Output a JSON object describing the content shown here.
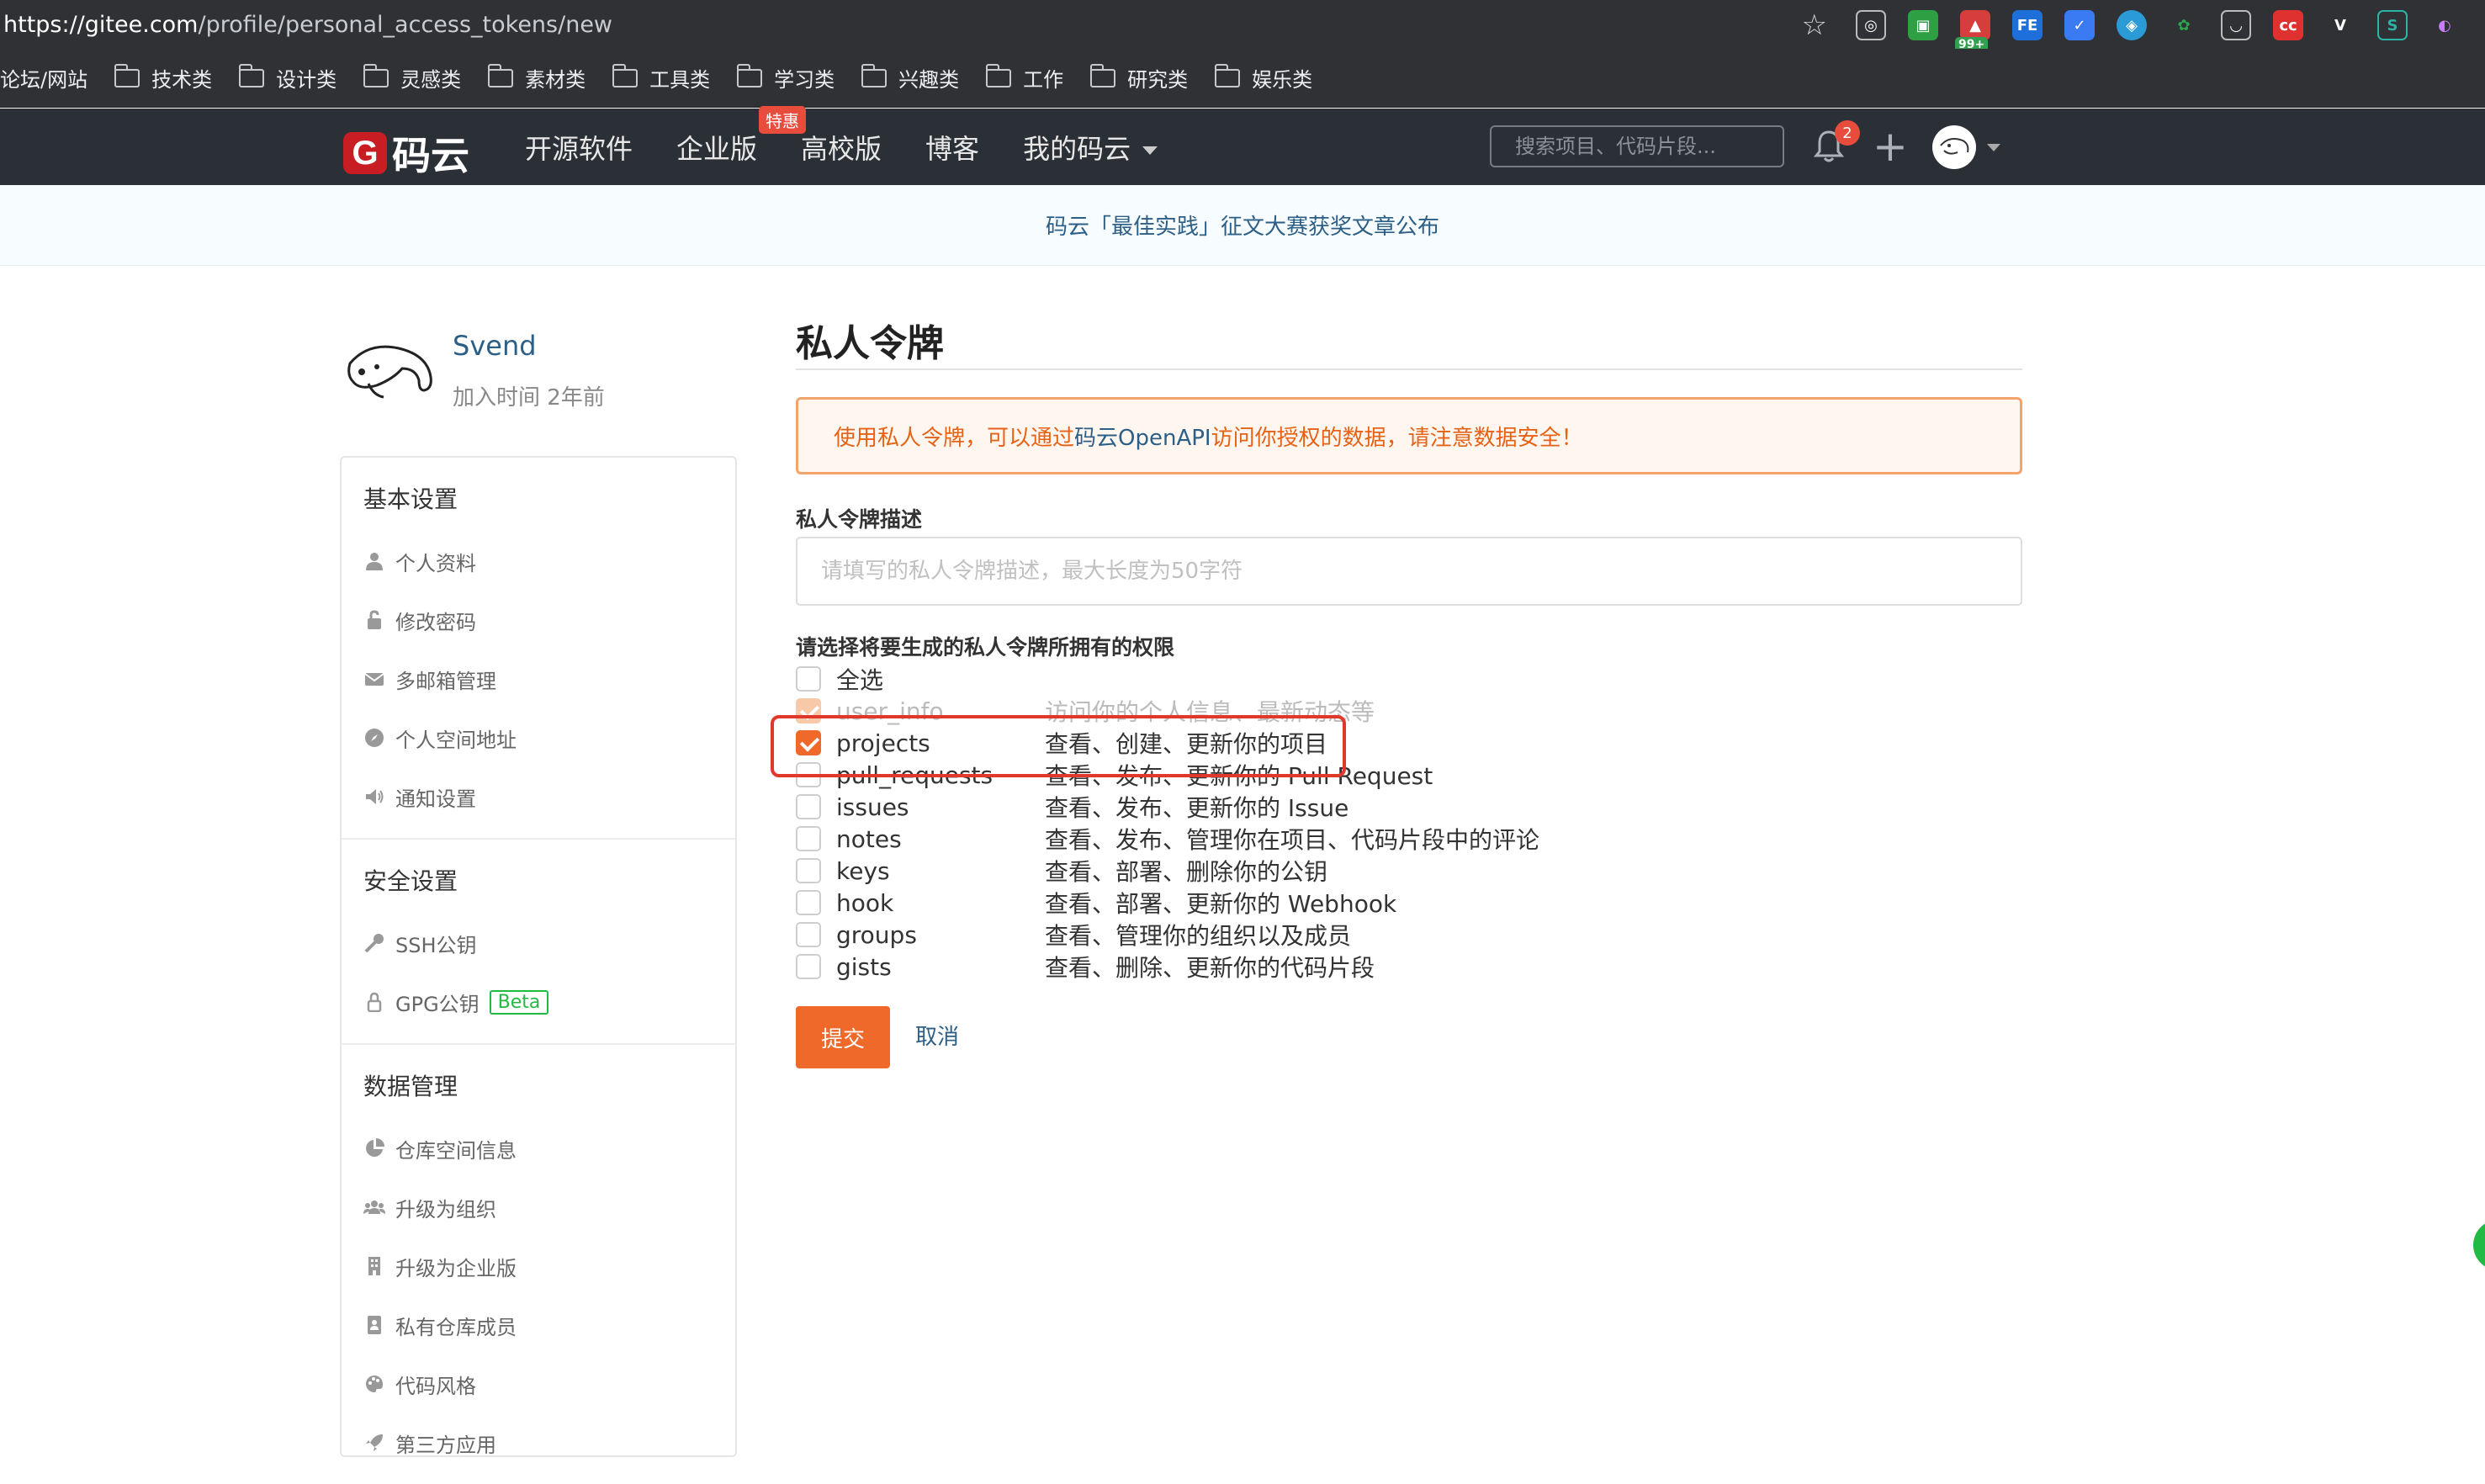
{
  "browser": {
    "url_host": "https://gitee.com",
    "url_path": "/profile/personal_access_tokens/new",
    "extension_badge": "99+",
    "bookmarks": [
      "论坛/网站",
      "技术类",
      "设计类",
      "灵感类",
      "素材类",
      "工具类",
      "学习类",
      "兴趣类",
      "工作",
      "研究类",
      "娱乐类"
    ]
  },
  "header": {
    "logo_letter": "G",
    "logo_text": "码云",
    "nav": [
      "开源软件",
      "企业版",
      "高校版",
      "博客",
      "我的码云"
    ],
    "enterprise_badge": "特惠",
    "search_placeholder": "搜索项目、代码片段...",
    "notification_count": "2"
  },
  "announcement": "码云「最佳实践」征文大赛获奖文章公布",
  "profile": {
    "name": "Svend",
    "joined": "加入时间 2年前"
  },
  "sidebar": {
    "sections": [
      {
        "title": "基本设置",
        "items": [
          {
            "label": "个人资料",
            "icon": "user-icon"
          },
          {
            "label": "修改密码",
            "icon": "lock-icon"
          },
          {
            "label": "多邮箱管理",
            "icon": "envelope-icon"
          },
          {
            "label": "个人空间地址",
            "icon": "compass-icon"
          },
          {
            "label": "通知设置",
            "icon": "speaker-icon"
          }
        ]
      },
      {
        "title": "安全设置",
        "items": [
          {
            "label": "SSH公钥",
            "icon": "key-icon"
          },
          {
            "label": "GPG公钥",
            "icon": "gpg-lock-icon",
            "badge": "Beta"
          }
        ]
      },
      {
        "title": "数据管理",
        "items": [
          {
            "label": "仓库空间信息",
            "icon": "pie-chart-icon"
          },
          {
            "label": "升级为组织",
            "icon": "users-icon"
          },
          {
            "label": "升级为企业版",
            "icon": "building-icon"
          },
          {
            "label": "私有仓库成员",
            "icon": "id-card-icon"
          },
          {
            "label": "代码风格",
            "icon": "palette-icon"
          },
          {
            "label": "第三方应用",
            "icon": "rocket-icon"
          }
        ]
      }
    ]
  },
  "form": {
    "title": "私人令牌",
    "alert_before": "使用私人令牌，可以通过 ",
    "alert_link": "码云OpenAPI",
    "alert_after": " 访问你授权的数据，请注意数据安全！",
    "desc_label": "私人令牌描述",
    "desc_placeholder": "请填写的私人令牌描述，最大长度为50字符",
    "perm_label": "请选择将要生成的私人令牌所拥有的权限",
    "select_all": "全选",
    "permissions": [
      {
        "name": "user_info",
        "desc": "访问你的个人信息、最新动态等",
        "checked": true,
        "faded": true
      },
      {
        "name": "projects",
        "desc": "查看、创建、更新你的项目",
        "checked": true,
        "faded": false
      },
      {
        "name": "pull_requests",
        "desc": "查看、发布、更新你的 Pull Request",
        "checked": false,
        "faded": false
      },
      {
        "name": "issues",
        "desc": "查看、发布、更新你的 Issue",
        "checked": false,
        "faded": false
      },
      {
        "name": "notes",
        "desc": "查看、发布、管理你在项目、代码片段中的评论",
        "checked": false,
        "faded": false
      },
      {
        "name": "keys",
        "desc": "查看、部署、删除你的公钥",
        "checked": false,
        "faded": false
      },
      {
        "name": "hook",
        "desc": "查看、部署、更新你的 Webhook",
        "checked": false,
        "faded": false
      },
      {
        "name": "groups",
        "desc": "查看、管理你的组织以及成员",
        "checked": false,
        "faded": false
      },
      {
        "name": "gists",
        "desc": "查看、删除、更新你的代码片段",
        "checked": false,
        "faded": false
      }
    ],
    "submit_label": "提交",
    "cancel_label": "取消"
  },
  "colors": {
    "accent": "#ef6a2a",
    "link": "#2d5f86",
    "header_bg": "#2b3037",
    "highlight": "#e0392b"
  }
}
